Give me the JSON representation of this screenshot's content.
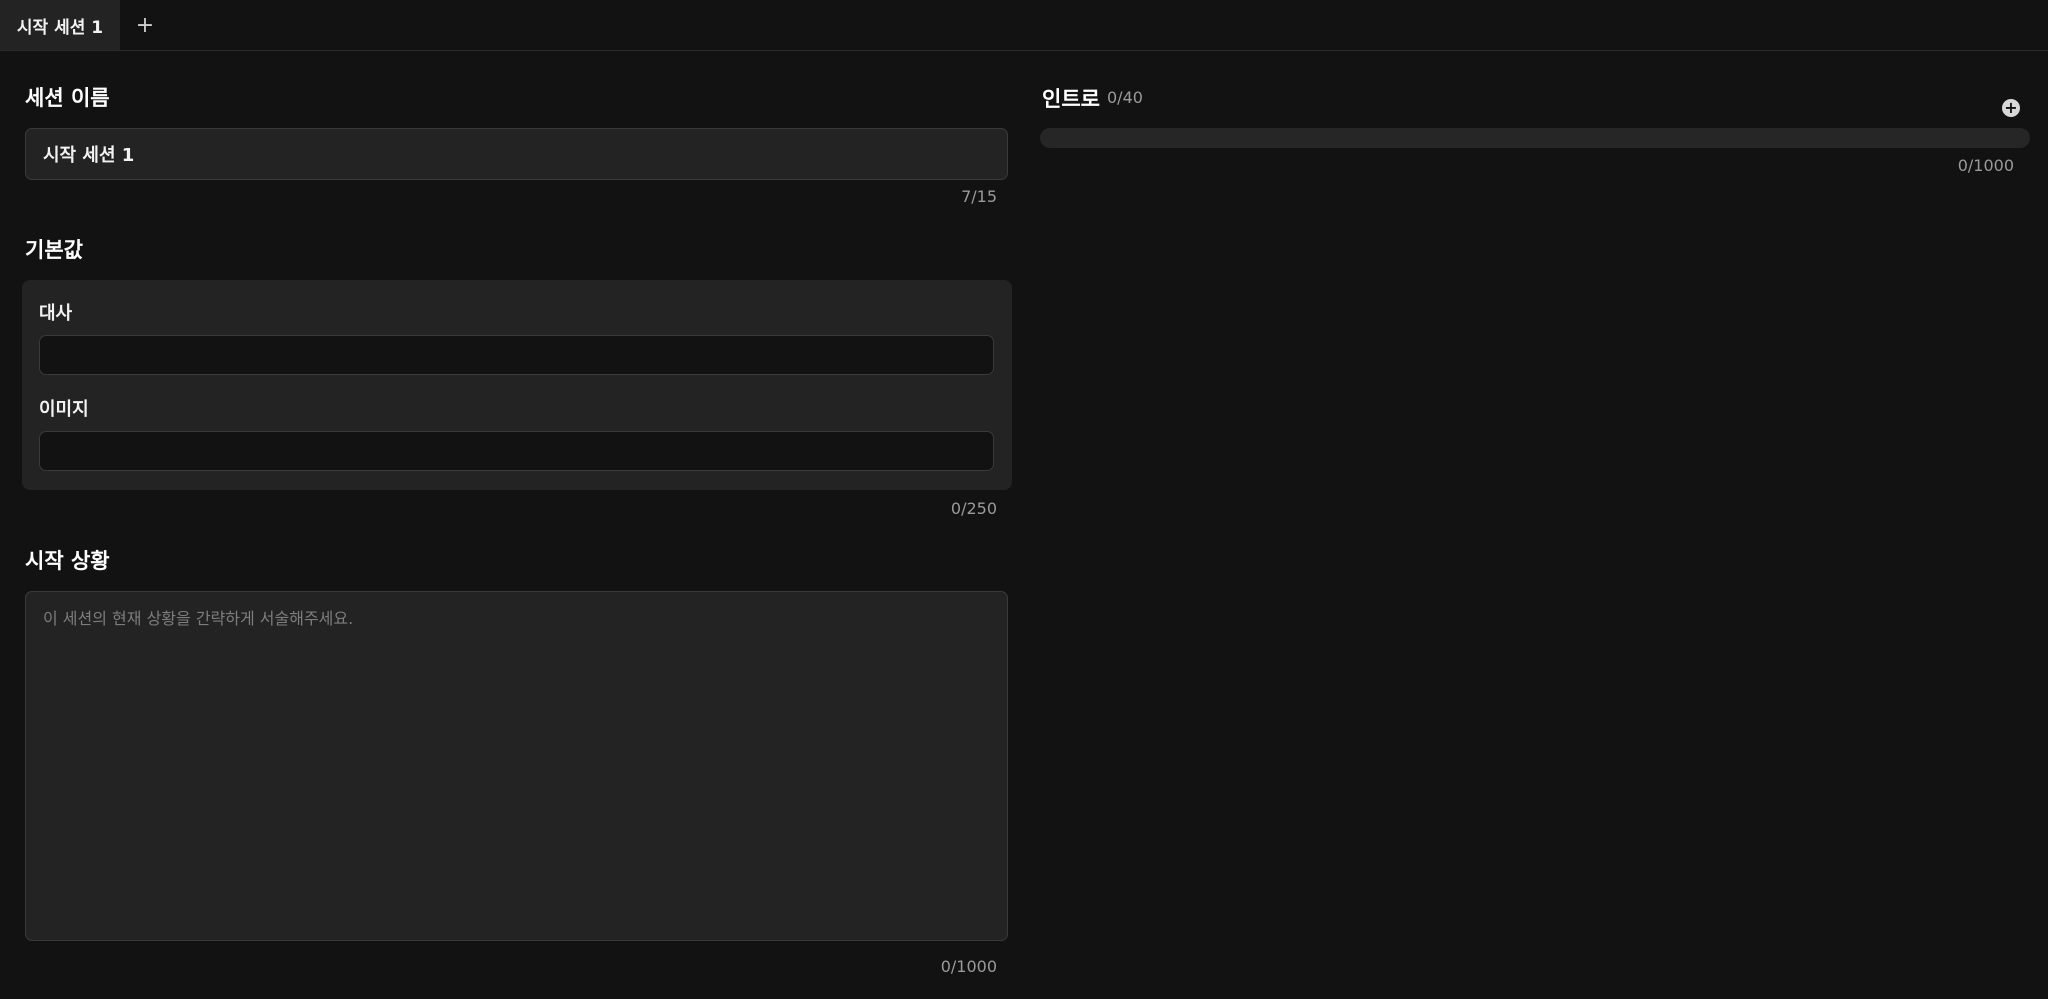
{
  "tabs": {
    "active_label": "시작 세션 1",
    "add_icon": "+"
  },
  "session_name": {
    "heading": "세션 이름",
    "value": "시작 세션 1",
    "counter": "7/15"
  },
  "defaults": {
    "heading": "기본값",
    "dialogue_label": "대사",
    "dialogue_value": "",
    "image_label": "이미지",
    "image_value": "",
    "counter": "0/250"
  },
  "start_situation": {
    "heading": "시작 상황",
    "placeholder": "이 세션의 현재 상황을 간략하게 서술해주세요.",
    "counter": "0/1000"
  },
  "intro": {
    "heading": "인트로",
    "count": "0/40",
    "add_icon": "plus-circle-icon",
    "counter": "0/1000"
  }
}
